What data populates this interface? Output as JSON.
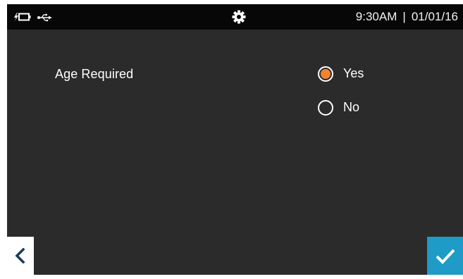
{
  "status_bar": {
    "icons": {
      "battery": "battery-charging-icon",
      "usb": "usb-icon",
      "settings": "gear-icon"
    },
    "time": "9:30AM",
    "separator": "|",
    "date": "01/01/16"
  },
  "setting": {
    "label": "Age Required",
    "options": [
      {
        "label": "Yes",
        "selected": true
      },
      {
        "label": "No",
        "selected": false
      }
    ]
  },
  "navigation": {
    "back_icon": "chevron-left-icon",
    "confirm_icon": "checkmark-icon"
  },
  "colors": {
    "screen_background": "#2b2b2b",
    "status_bar_background": "#070707",
    "selected_radio": "#f08430",
    "confirm_button": "#1e9bc6",
    "back_button": "#ffffff",
    "back_chevron": "#1b3a5e"
  }
}
